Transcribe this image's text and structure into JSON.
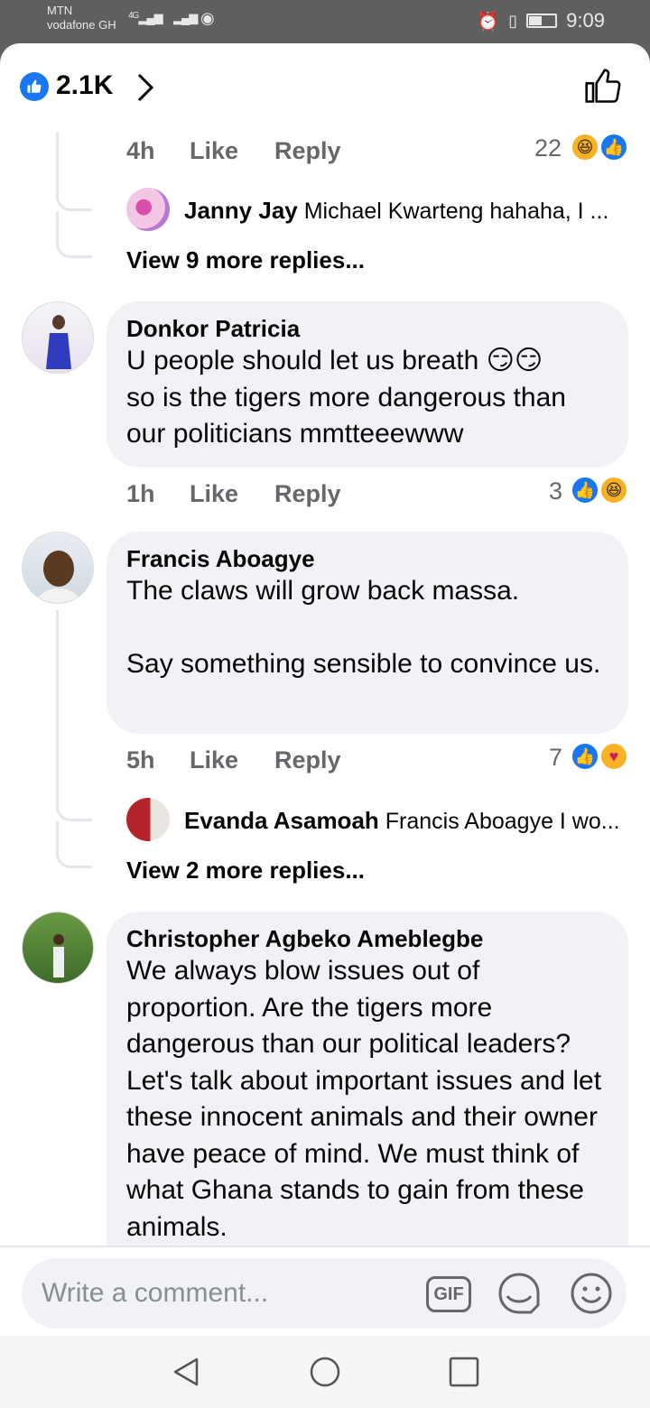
{
  "status": {
    "carrier1": "MTN",
    "carrier2": "vodafone GH",
    "network": "4G",
    "time": "9:09"
  },
  "reactions_header": {
    "count": "2.1K",
    "icons": [
      "like-icon",
      "chevron-right-icon",
      "thumbs-up-outline-icon"
    ]
  },
  "thread1": {
    "time": "4h",
    "like_label": "Like",
    "reply_label": "Reply",
    "reaction_count": "22",
    "reply_preview": {
      "name": "Janny Jay",
      "text": "Michael Kwarteng hahaha, I ..."
    },
    "view_more": "View 9 more replies..."
  },
  "comments": [
    {
      "name": "Donkor Patricia",
      "text": "U people should let us breath 😏😏\nso is the tigers more dangerous than our politicians mmtteeewww",
      "time": "1h",
      "like_label": "Like",
      "reply_label": "Reply",
      "reaction_count": "3"
    },
    {
      "name": "Francis Aboagye",
      "text": "The claws will grow back massa.\n\nSay something sensible to convince us.",
      "time": "5h",
      "like_label": "Like",
      "reply_label": "Reply",
      "reaction_count": "7",
      "reply_preview": {
        "name": "Evanda Asamoah",
        "text": "Francis Aboagye I wo..."
      },
      "view_more": "View 2 more replies..."
    },
    {
      "name": "Christopher Agbeko Ameblegbe",
      "text": "We always blow issues out of proportion. Are the tigers more dangerous than our political leaders? Let's talk about important issues and let these innocent animals and their owner have peace of mind. We must think of what Ghana stands to gain from these animals."
    }
  ],
  "composer": {
    "placeholder": "Write a comment...",
    "gif_label": "GIF"
  },
  "colors": {
    "facebook_blue": "#1877f2",
    "bubble_bg": "#f0f2f5",
    "meta_gray": "#65676b"
  }
}
